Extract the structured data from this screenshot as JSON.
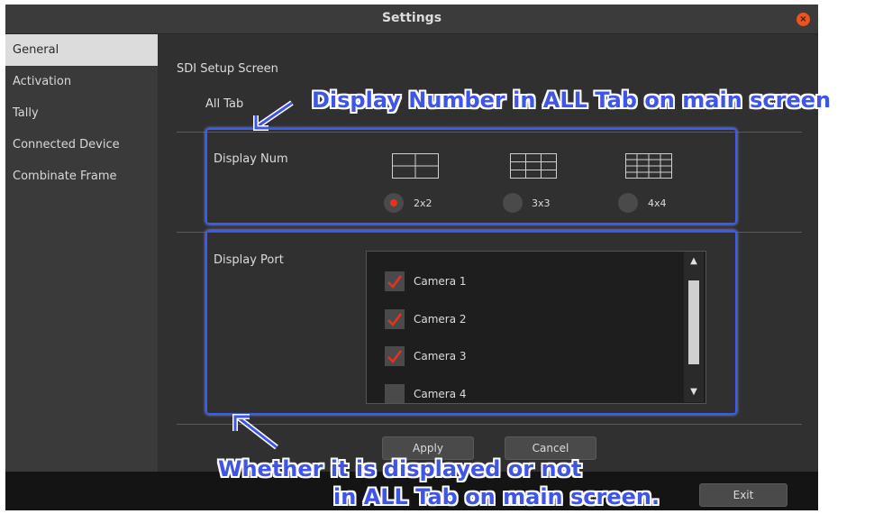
{
  "window": {
    "title": "Settings",
    "close_glyph": "×"
  },
  "sidebar": {
    "items": [
      {
        "label": "General",
        "active": true
      },
      {
        "label": "Activation"
      },
      {
        "label": "Tally"
      },
      {
        "label": "Connected Device"
      },
      {
        "label": "Combinate Frame"
      }
    ]
  },
  "content": {
    "section_title": "SDI Setup Screen",
    "subtab_label": "All Tab",
    "display_num": {
      "label": "Display Num",
      "options": [
        {
          "label": "2x2",
          "checked": true
        },
        {
          "label": "3x3",
          "checked": false
        },
        {
          "label": "4x4",
          "checked": false
        }
      ]
    },
    "display_port": {
      "label": "Display Port",
      "cameras": [
        {
          "label": "Camera 1",
          "checked": true
        },
        {
          "label": "Camera 2",
          "checked": true
        },
        {
          "label": "Camera 3",
          "checked": true
        },
        {
          "label": "Camera 4",
          "checked": false
        }
      ]
    },
    "buttons": {
      "apply": "Apply",
      "cancel": "Cancel"
    }
  },
  "footer": {
    "exit_label": "Exit"
  },
  "annotations": {
    "top": "Display Number in ALL Tab on main screen",
    "bottom_line1": "Whether it is displayed or not",
    "bottom_line2": "in ALL Tab on main screen."
  },
  "colors": {
    "accent_check": "#e8321e",
    "annotation_blue": "#3f55e6",
    "close_button": "#e95420"
  }
}
